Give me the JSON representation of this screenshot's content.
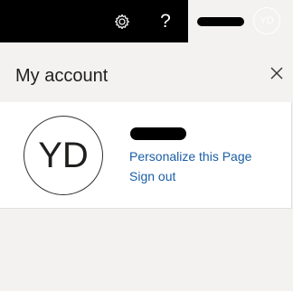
{
  "topbar": {
    "settings_icon": "gear-icon",
    "help_label": "?",
    "background": "#000000"
  },
  "account": {
    "avatar_initials_small": "YD"
  },
  "panel": {
    "title": "My account",
    "close_icon": "close-icon"
  },
  "profile": {
    "avatar_initials": "YD",
    "personalize_label": "Personalize this Page",
    "signout_label": "Sign out",
    "link_color": "#1a5ea6"
  }
}
